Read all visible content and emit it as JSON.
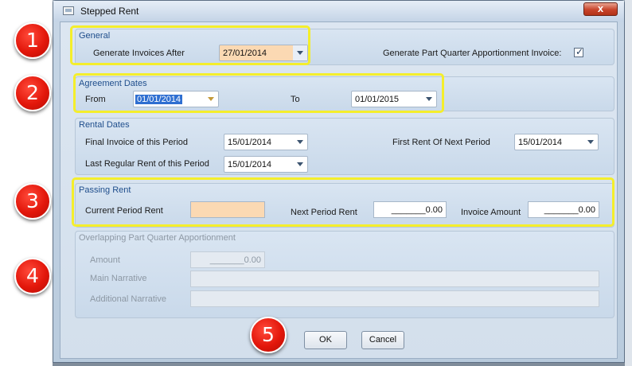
{
  "window": {
    "title": "Stepped Rent",
    "close_label": "x"
  },
  "general": {
    "legend": "General",
    "generate_after_label": "Generate Invoices After",
    "generate_after_value": "27/01/2014",
    "part_quarter_label": "Generate Part Quarter Apportionment Invoice:",
    "part_quarter_checked": "✓"
  },
  "agreement": {
    "legend": "Agreement Dates",
    "from_label": "From",
    "from_value": "01/01/2014",
    "to_label": "To",
    "to_value": "01/01/2015"
  },
  "rental": {
    "legend": "Rental Dates",
    "final_invoice_label": "Final Invoice of this Period",
    "final_invoice_value": "15/01/2014",
    "first_rent_label": "First Rent Of Next Period",
    "first_rent_value": "15/01/2014",
    "last_regular_label": "Last Regular Rent of this Period",
    "last_regular_value": "15/01/2014"
  },
  "passing": {
    "legend": "Passing Rent",
    "current_label": "Current Period  Rent",
    "current_value": "",
    "next_label": "Next Period Rent",
    "next_value": "_______0.00",
    "invoice_label": "Invoice Amount",
    "invoice_value": "_______0.00"
  },
  "overlap": {
    "legend": "Overlapping Part Quarter Apportionment",
    "amount_label": "Amount",
    "amount_value": "_______0.00",
    "main_label": "Main Narrative",
    "main_value": "",
    "additional_label": "Additional Narrative",
    "additional_value": ""
  },
  "buttons": {
    "ok": "OK",
    "cancel": "Cancel"
  },
  "badges": [
    "1",
    "2",
    "3",
    "4",
    "5"
  ],
  "colors": {
    "highlight": "#f4ee2c",
    "badge": "#e3170b",
    "peach": "#fbd9b3",
    "legend": "#1f4e8c"
  }
}
